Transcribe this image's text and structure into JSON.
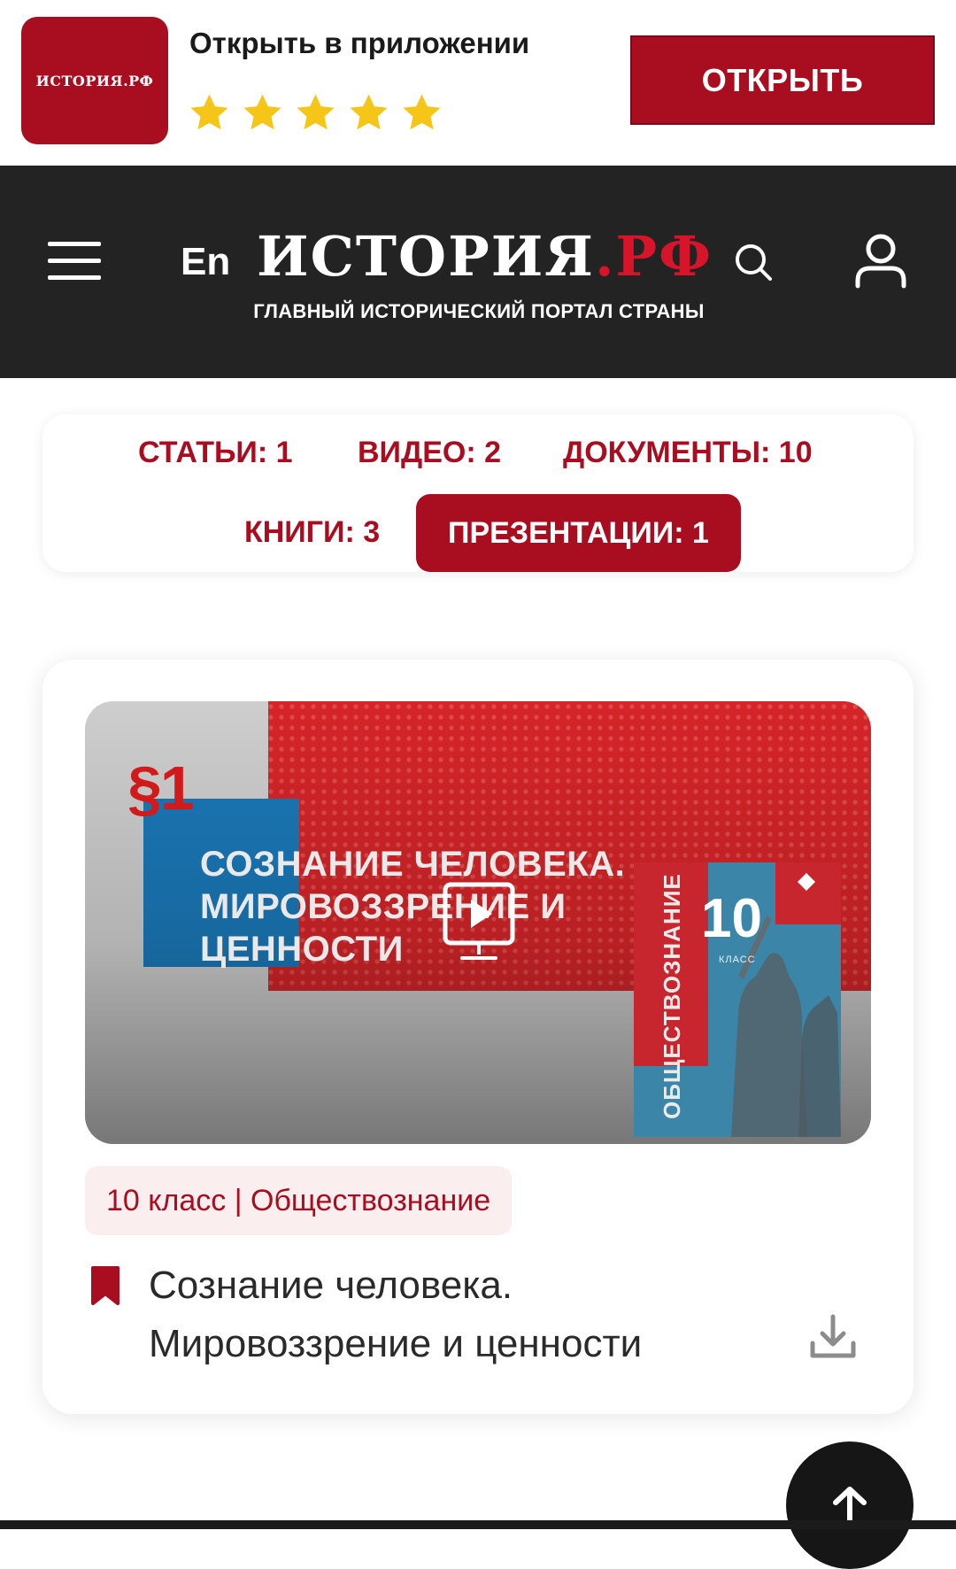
{
  "app_banner": {
    "logo_text": "ИСТОРИЯ.РФ",
    "text": "Открыть в приложении",
    "rating_stars": 5,
    "open_label": "ОТКРЫТЬ"
  },
  "header": {
    "lang": "En",
    "logo_main": "ИСТОРИЯ",
    "logo_accent": ".РФ",
    "tagline": "ГЛАВНЫЙ ИСТОРИЧЕСКИЙ ПОРТАЛ СТРАНЫ"
  },
  "tabs": [
    {
      "label": "СТАТЬИ: 1",
      "active": false
    },
    {
      "label": "ВИДЕО: 2",
      "active": false
    },
    {
      "label": "ДОКУМЕНТЫ: 10",
      "active": false
    },
    {
      "label": "КНИГИ: 3",
      "active": false
    },
    {
      "label": "ПРЕЗЕНТАЦИИ: 1",
      "active": true
    }
  ],
  "card": {
    "thumbnail": {
      "section": "§1",
      "slide_title": "СОЗНАНИЕ ЧЕЛОВЕКА. МИРОВОЗЗРЕНИЕ И ЦЕННОСТИ",
      "book_number": "10",
      "book_grade": "КЛАСС",
      "book_title": "ОБЩЕСТВОЗНАНИЕ"
    },
    "badge": "10 класс | Обществознание",
    "title": "Сознание человека. Мировоззрение и ценности"
  },
  "colors": {
    "brand": "#a80d20",
    "header_bg": "#232323",
    "star": "#f5c518"
  }
}
